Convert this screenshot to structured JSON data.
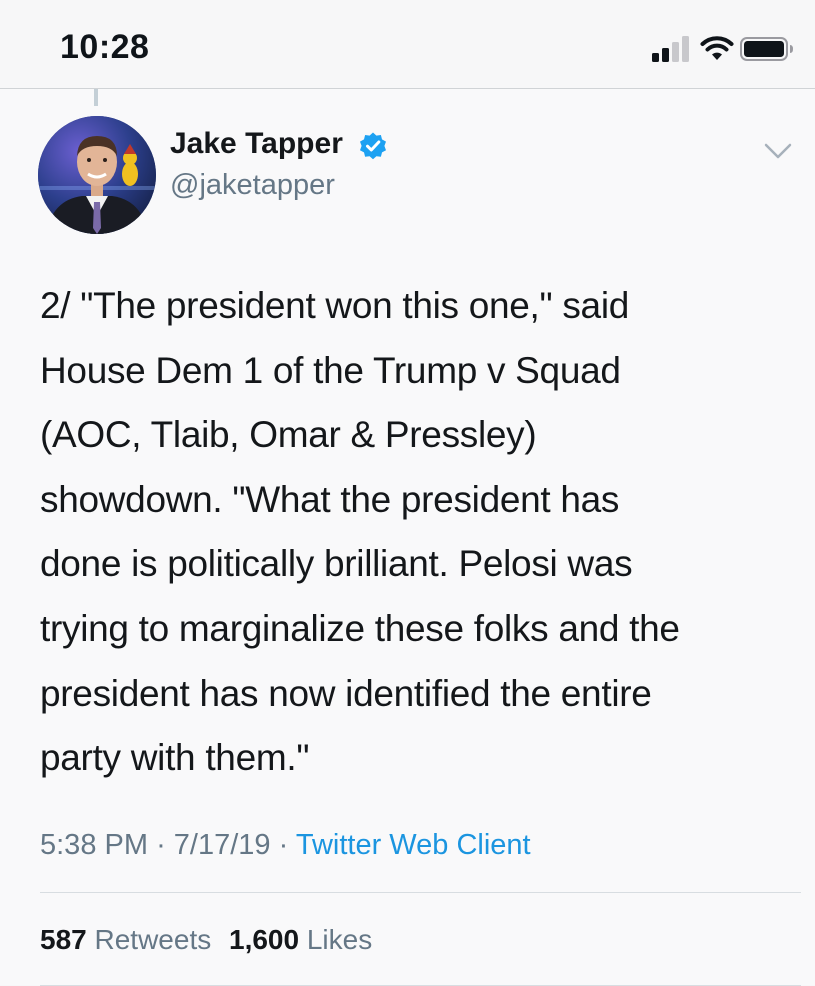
{
  "status_bar": {
    "time": "10:28"
  },
  "tweet": {
    "display_name": "Jake Tapper",
    "handle": "@jaketapper",
    "verified": true,
    "text_lines": [
      "2/ \"The president won this one,\" said",
      "House Dem 1 of the Trump v Squad",
      "(AOC, Tlaib, Omar & Pressley)",
      "showdown. \"What the president has",
      "done is politically brilliant. Pelosi was",
      "trying to marginalize these folks and the",
      "president has now identified the entire",
      "party with them.\""
    ],
    "time": "5:38 PM",
    "date": "7/17/19",
    "separator": "·",
    "client": "Twitter Web Client",
    "retweets_count": "587",
    "retweets_label": "Retweets",
    "likes_count": "1,600",
    "likes_label": "Likes"
  },
  "icons": {
    "signal": "cellular-signal-icon",
    "wifi": "wifi-icon",
    "battery": "battery-icon",
    "verified": "verified-badge-icon",
    "chevron": "chevron-down-icon",
    "avatar": "profile-avatar"
  },
  "colors": {
    "link": "#1b95e0",
    "secondary_text": "#657786",
    "primary_text": "#14171a",
    "verified_blue": "#1da1f2"
  }
}
